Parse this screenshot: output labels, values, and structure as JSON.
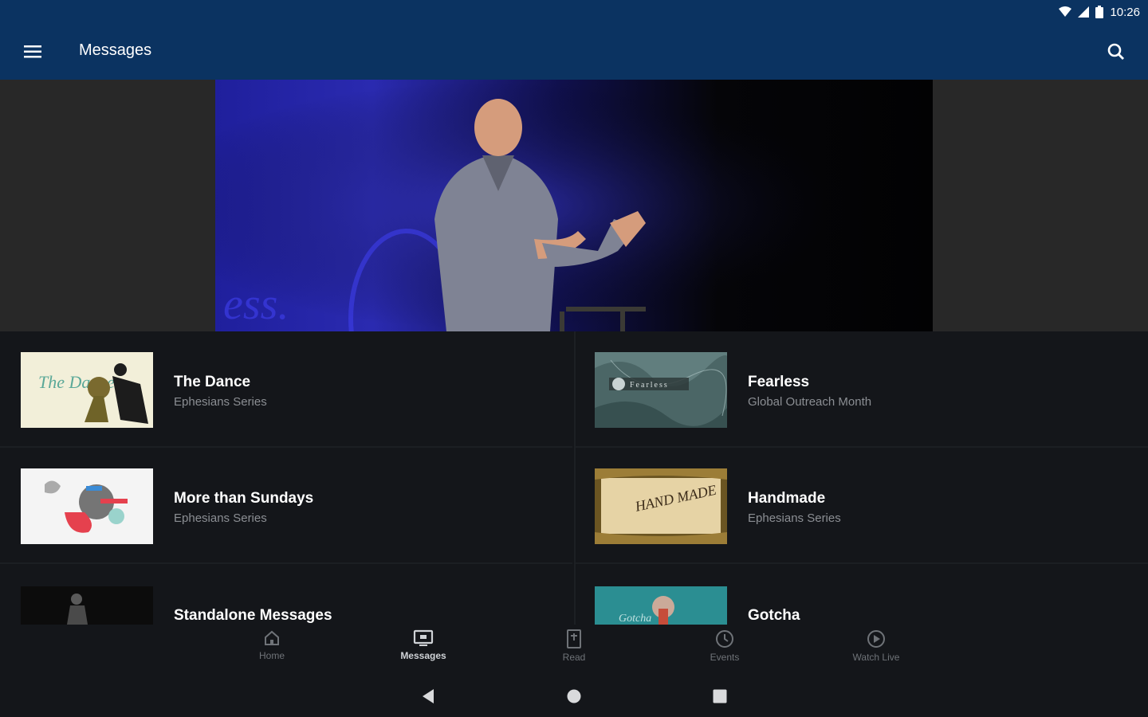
{
  "status_bar": {
    "time": "10:26"
  },
  "header": {
    "title": "Messages"
  },
  "items": [
    {
      "title": "The Dance",
      "subtitle": "Ephesians Series",
      "thumb_text": "The Dance"
    },
    {
      "title": "Fearless",
      "subtitle": "Global Outreach Month",
      "thumb_text": "Fearless"
    },
    {
      "title": "More than Sundays",
      "subtitle": "Ephesians Series"
    },
    {
      "title": "Handmade",
      "subtitle": "Ephesians Series",
      "thumb_text": "HAND MADE"
    },
    {
      "title": "Standalone Messages",
      "subtitle": ""
    },
    {
      "title": "Gotcha",
      "subtitle": "",
      "thumb_text": "Gotcha"
    }
  ],
  "bottom_nav": [
    {
      "label": "Home",
      "icon": "home-icon"
    },
    {
      "label": "Messages",
      "icon": "tv-icon",
      "active": true
    },
    {
      "label": "Read",
      "icon": "bible-icon"
    },
    {
      "label": "Events",
      "icon": "clock-icon"
    },
    {
      "label": "Watch Live",
      "icon": "play-circle-icon"
    }
  ],
  "colors": {
    "appbar": "#0b3361",
    "background": "#14161a"
  }
}
